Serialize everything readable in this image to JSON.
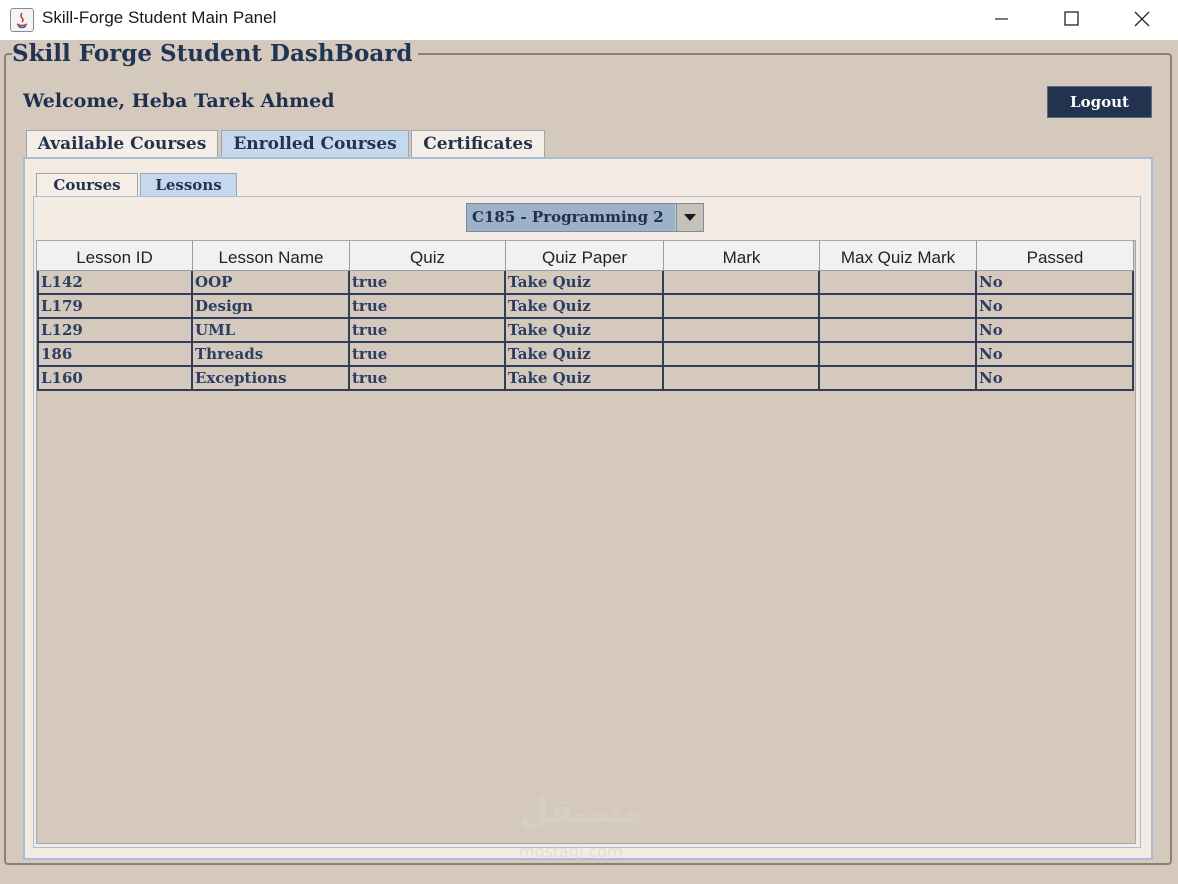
{
  "window": {
    "title": "Skill-Forge Student Main Panel",
    "controls": [
      "minimize",
      "maximize",
      "close"
    ]
  },
  "dashboard": {
    "title": "Skill Forge Student DashBoard",
    "welcome": "Welcome, Heba Tarek Ahmed",
    "logout_label": "Logout"
  },
  "tabs": [
    {
      "label": "Available Courses",
      "selected": false
    },
    {
      "label": "Enrolled Courses",
      "selected": true
    },
    {
      "label": "Certificates",
      "selected": false
    }
  ],
  "subtabs": [
    {
      "label": "Courses",
      "selected": false
    },
    {
      "label": "Lessons",
      "selected": true
    }
  ],
  "course_select": {
    "value": "C185 - Programming 2"
  },
  "table": {
    "columns": [
      "Lesson ID",
      "Lesson Name",
      "Quiz",
      "Quiz Paper",
      "Mark",
      "Max Quiz Mark",
      "Passed"
    ],
    "rows": [
      [
        "L142",
        "OOP",
        "true",
        "Take Quiz",
        "",
        "",
        "No"
      ],
      [
        "L179",
        "Design",
        "true",
        "Take Quiz",
        "",
        "",
        "No"
      ],
      [
        "L129",
        "UML",
        "true",
        "Take Quiz",
        "",
        "",
        "No"
      ],
      [
        "186",
        "Threads",
        "true",
        "Take Quiz",
        "",
        "",
        "No"
      ],
      [
        "L160",
        "Exceptions",
        "true",
        "Take Quiz",
        "",
        "",
        "No"
      ]
    ]
  },
  "watermark": {
    "text": "مستقل",
    "subtext": "mostaql.com"
  },
  "colors": {
    "frame_bg": "#d4c9bc",
    "accent_dark": "#23334f",
    "selected_tab": "#c4d9ee",
    "combo_bg": "#9db1c8"
  }
}
